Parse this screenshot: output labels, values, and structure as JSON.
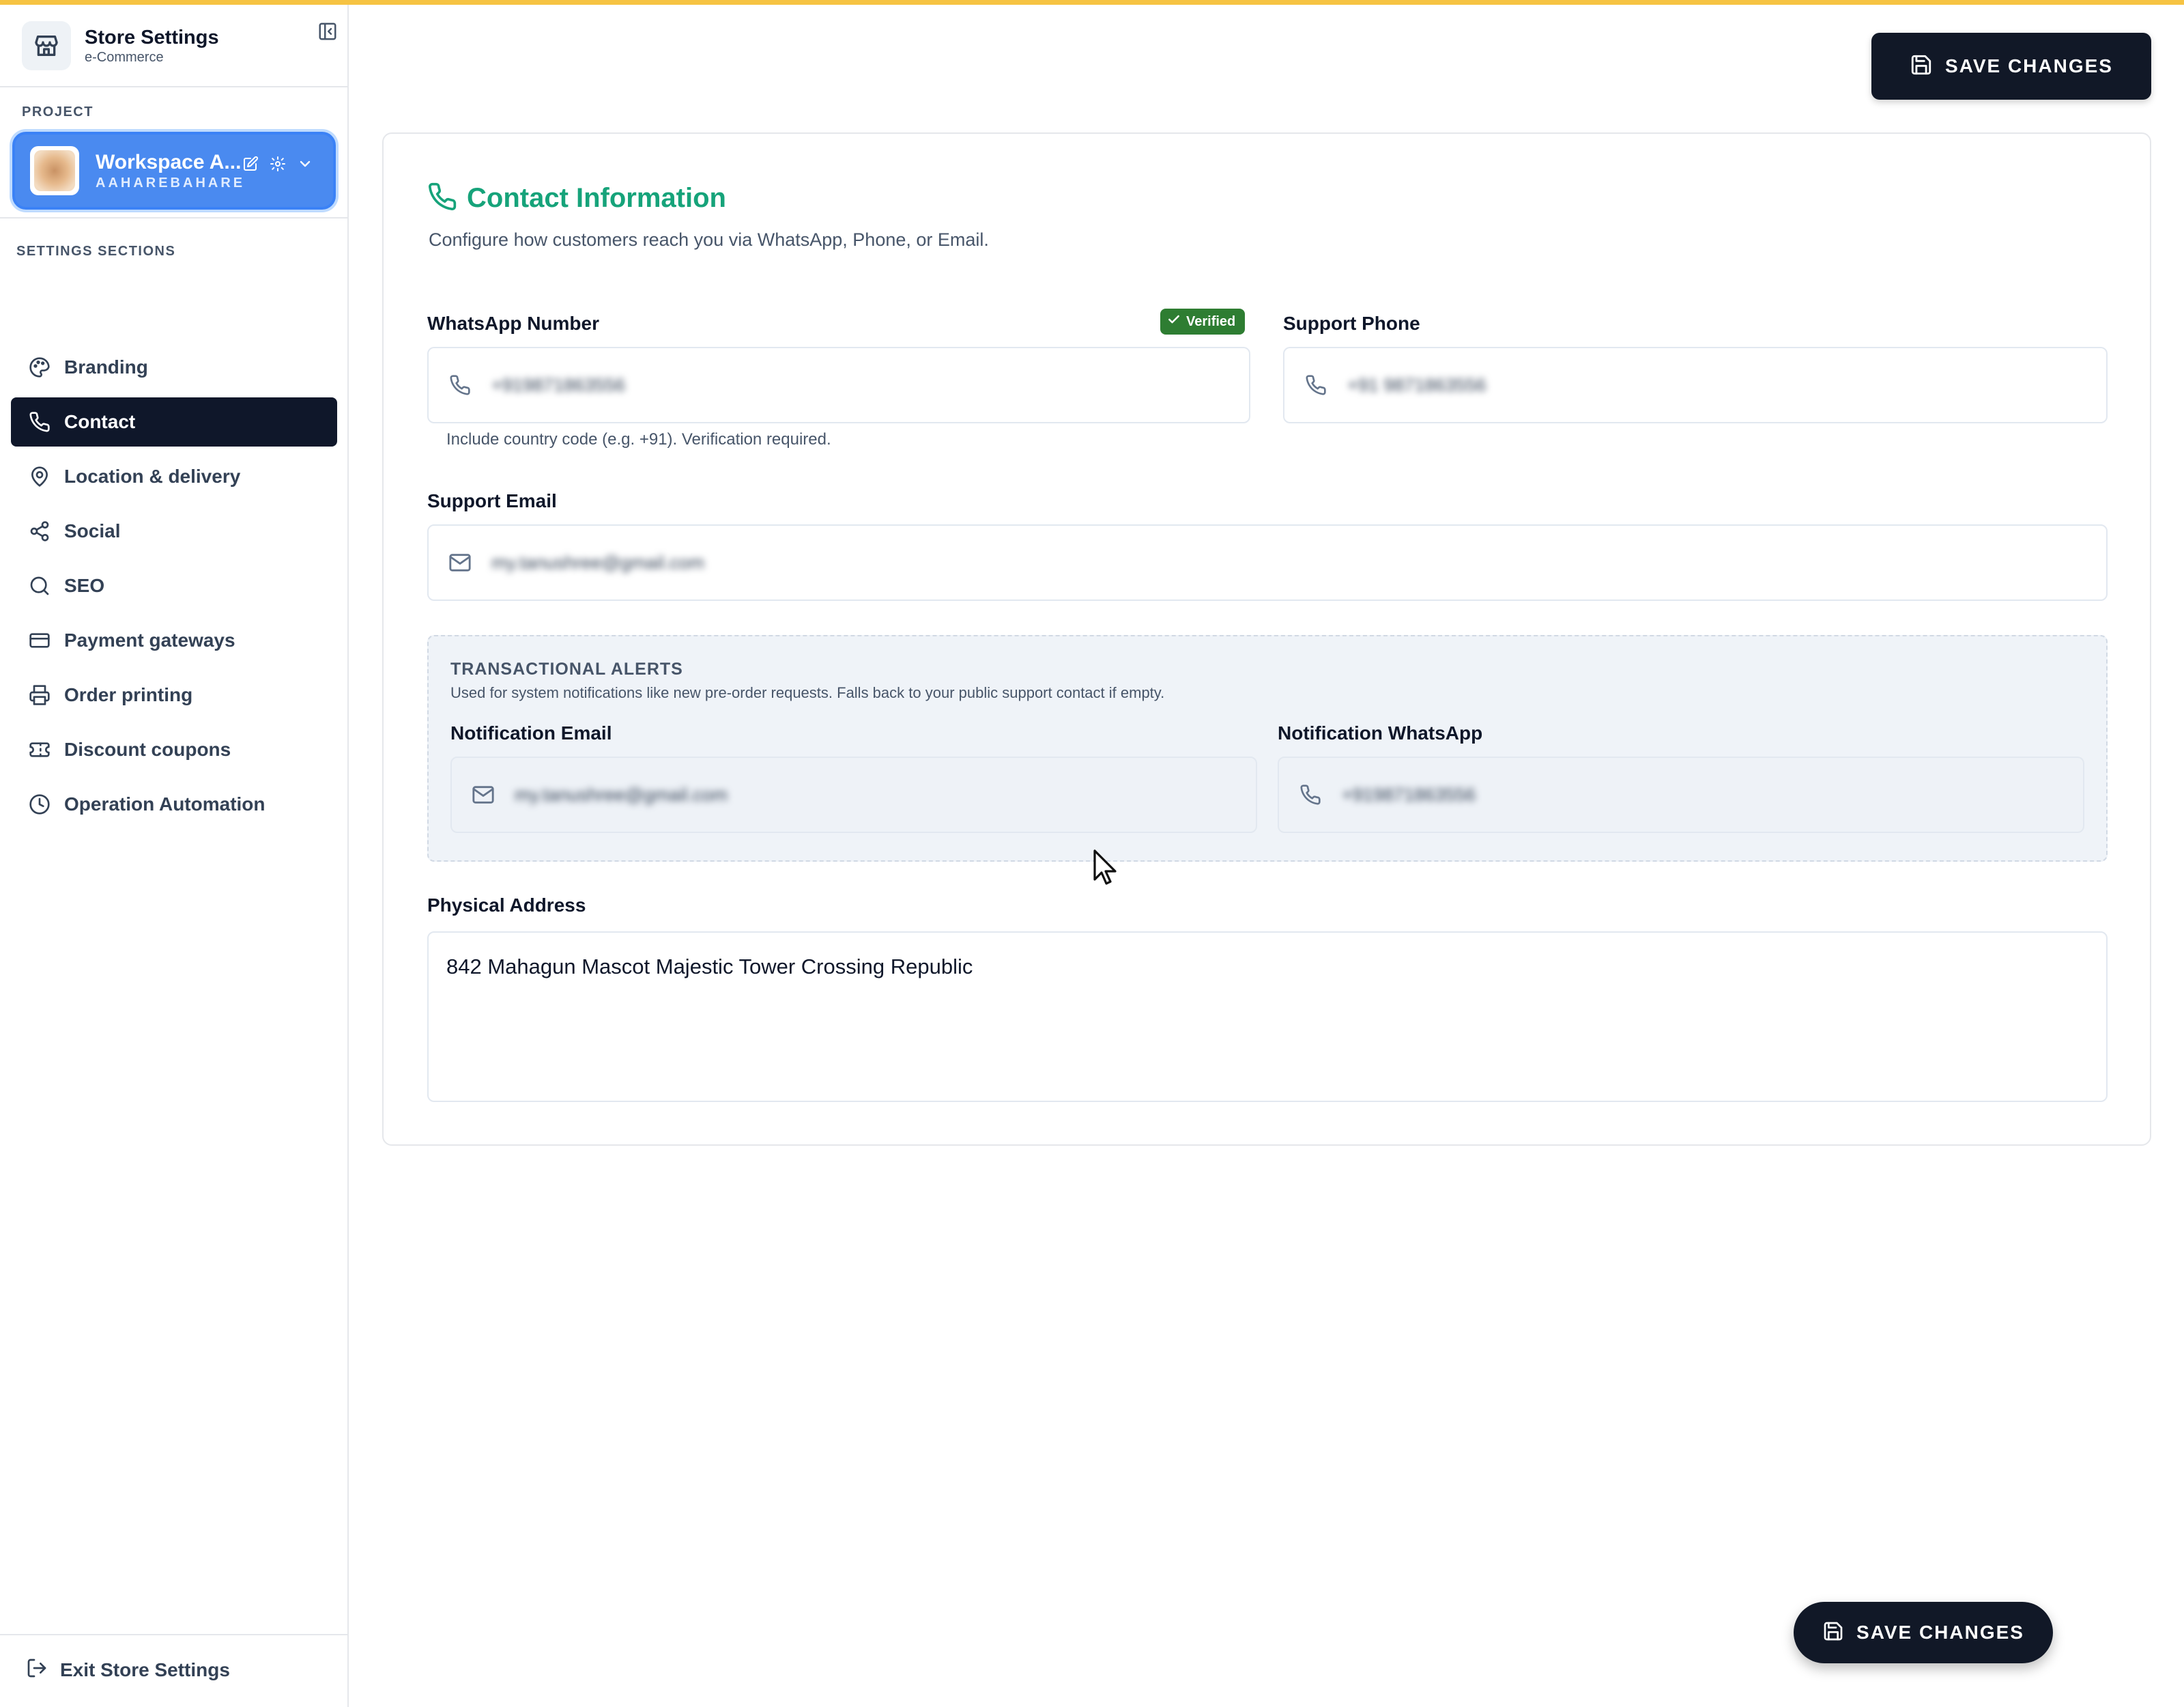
{
  "app": {
    "title": "Store Settings",
    "subtitle": "e-Commerce",
    "accent_color": "#f6c343",
    "success_color": "#16a37a"
  },
  "sidebar": {
    "project_label": "PROJECT",
    "project": {
      "name": "Workspace A...",
      "slug": "AAHAREBAHARE"
    },
    "sections_label": "SETTINGS SECTIONS",
    "items": [
      {
        "label": "Branding",
        "icon": "palette-icon",
        "active": false
      },
      {
        "label": "Contact",
        "icon": "phone-icon",
        "active": true
      },
      {
        "label": "Location & delivery",
        "icon": "map-pin-icon",
        "active": false
      },
      {
        "label": "Social",
        "icon": "share-icon",
        "active": false
      },
      {
        "label": "SEO",
        "icon": "search-icon",
        "active": false
      },
      {
        "label": "Payment gateways",
        "icon": "credit-card-icon",
        "active": false
      },
      {
        "label": "Order printing",
        "icon": "printer-icon",
        "active": false
      },
      {
        "label": "Discount coupons",
        "icon": "ticket-icon",
        "active": false
      },
      {
        "label": "Operation Automation",
        "icon": "clock-icon",
        "active": false
      }
    ],
    "exit_label": "Exit Store Settings"
  },
  "toolbar": {
    "save_label": "SAVE CHANGES"
  },
  "contact": {
    "title": "Contact Information",
    "description": "Configure how customers reach you via WhatsApp, Phone, or Email.",
    "whatsapp": {
      "label": "WhatsApp Number",
      "badge": "Verified",
      "value": "+919871863556",
      "hint": "Include country code (e.g. +91). Verification required."
    },
    "support_phone": {
      "label": "Support Phone",
      "value": "+91 9871863556"
    },
    "support_email": {
      "label": "Support Email",
      "value": "my.tanushree@gmail.com"
    },
    "alerts": {
      "title": "TRANSACTIONAL ALERTS",
      "description": "Used for system notifications like new pre-order requests. Falls back to your public support contact if empty.",
      "email": {
        "label": "Notification Email",
        "value": "my.tanushree@gmail.com"
      },
      "whatsapp": {
        "label": "Notification WhatsApp",
        "value": "+919871863556"
      }
    },
    "address": {
      "label": "Physical Address",
      "value": "842 Mahagun Mascot Majestic Tower Crossing Republic"
    }
  },
  "floating": {
    "save_label": "SAVE CHANGES"
  }
}
